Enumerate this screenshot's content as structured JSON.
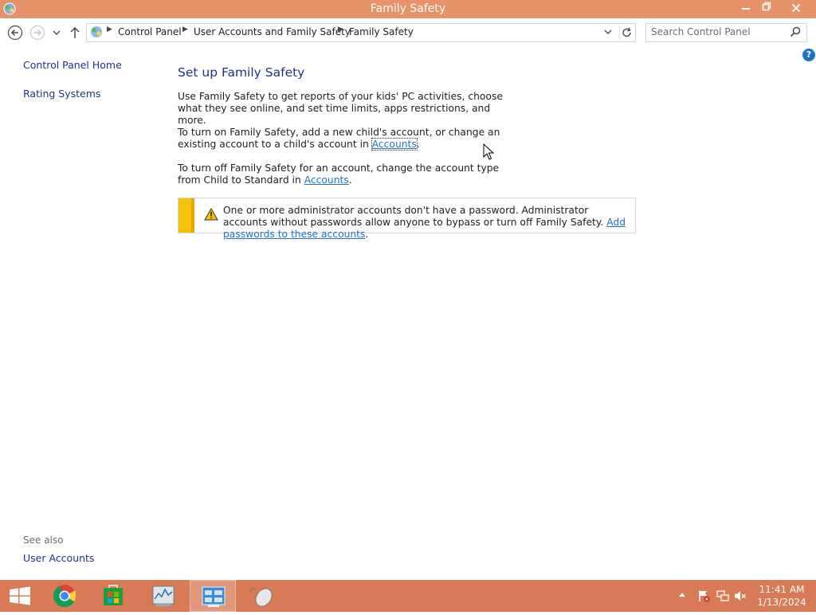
{
  "window": {
    "title": "Family Safety",
    "minimize_icon": "minimize-icon",
    "restore_icon": "restore-icon",
    "close_icon": "close-icon"
  },
  "nav": {
    "breadcrumb": [
      "Control Panel",
      "User Accounts and Family Safety",
      "Family Safety"
    ],
    "search_placeholder": "Search Control Panel"
  },
  "left_pane": {
    "links": [
      "Control Panel Home",
      "Rating Systems"
    ],
    "see_also_label": "See also",
    "see_also_links": [
      "User Accounts"
    ]
  },
  "main": {
    "heading": "Set up Family Safety",
    "p1": "Use Family Safety to get reports of your kids' PC activities, choose what they see online, and set time limits, apps restrictions, and more.",
    "p2_text": "To turn on Family Safety, add a new child's account, or change an existing account to a child's account in ",
    "p2_link": "Accounts",
    "p2_end": ".",
    "p3_text": "To turn off Family Safety for an account, change the account type from Child to Standard in ",
    "p3_link": "Accounts",
    "p3_end": ".",
    "warning_text": "One or more administrator accounts don't have a password. Administrator accounts without passwords allow anyone to bypass or turn off Family Safety. ",
    "warning_link": "Add passwords to these accounts",
    "warning_end": "."
  },
  "taskbar": {
    "apps": [
      "start-icon",
      "chrome-icon",
      "store-icon",
      "performance-monitor-icon",
      "control-panel-icon",
      "mouse-icon"
    ],
    "active_app": "control-panel-icon",
    "clock_time": "11:41 AM",
    "clock_date": "1/13/2024"
  },
  "colors": {
    "titlebar": "#e8926a",
    "taskbar": "#d87a55",
    "link": "#1e72c8",
    "heading": "#1e3287",
    "warning_bar": "#f4c20c"
  }
}
